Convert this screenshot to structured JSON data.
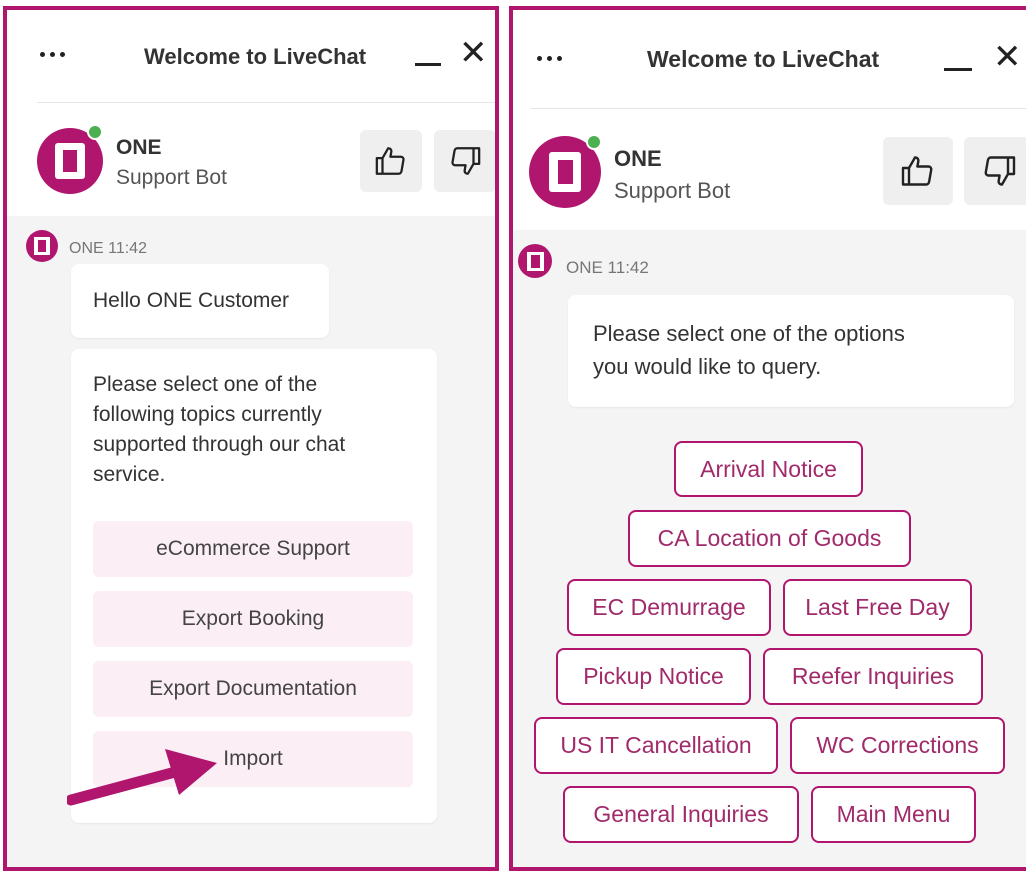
{
  "header": {
    "title": "Welcome to LiveChat"
  },
  "agent": {
    "name": "ONE",
    "role": "Support Bot"
  },
  "left_chat": {
    "meta": "ONE 11:42",
    "greeting": "Hello ONE Customer",
    "prompt_lines": [
      "Please select one of the",
      "following topics currently",
      "supported through our chat",
      "service."
    ],
    "options": [
      "eCommerce Support",
      "Export Booking",
      "Export Documentation",
      "Import"
    ]
  },
  "right_chat": {
    "meta": "ONE 11:42",
    "prompt_lines": [
      "Please select one of the options",
      "you would like to query."
    ],
    "options": [
      "Arrival Notice",
      "CA Location of Goods",
      "EC Demurrage",
      "Last Free Day",
      "Pickup Notice",
      "Reefer Inquiries",
      "US IT Cancellation",
      "WC Corrections",
      "General Inquiries",
      "Main Menu"
    ]
  },
  "colors": {
    "brand": "#b0166e",
    "online": "#4caf50",
    "option_bg": "#fbeef5"
  },
  "icons": [
    "more-dots-icon",
    "minimize-icon",
    "close-icon",
    "thumbs-up-icon",
    "thumbs-down-icon",
    "annotation-arrow"
  ]
}
